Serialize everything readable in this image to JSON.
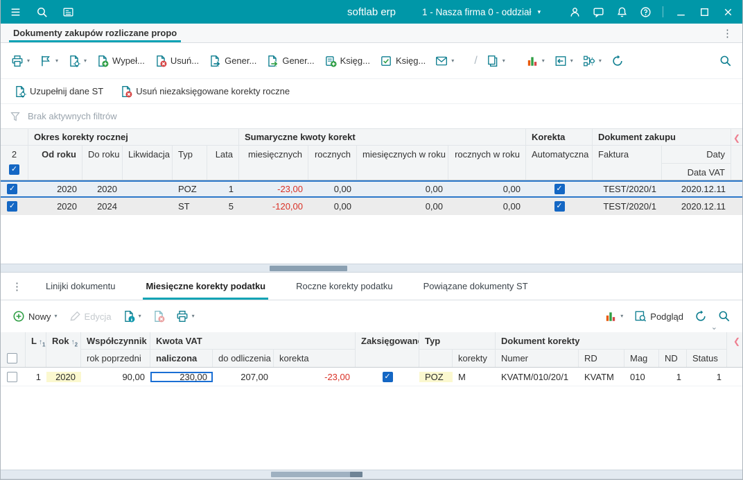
{
  "titlebar": {
    "app_name": "softlab erp",
    "company": "1 - Nasza firma 0 - oddział"
  },
  "tabbar": {
    "active_tab": "Dokumenty zakupów rozliczane propo"
  },
  "toolbar": {
    "wypelnij": "Wypeł...",
    "usun": "Usuń...",
    "generuj1": "Gener...",
    "generuj2": "Gener...",
    "ksieguj1": "Księg...",
    "ksieguj2": "Księg..."
  },
  "toolbar2": {
    "uzupelnij": "Uzupełnij dane ST",
    "usun_korekty": "Usuń niezaksięgowane korekty roczne"
  },
  "filterbar": {
    "status": "Brak aktywnych filtrów"
  },
  "main_table": {
    "record_count": "2",
    "groups": {
      "okres": "Okres korekty rocznej",
      "sumaryczne": "Sumaryczne kwoty korekt",
      "korekta": "Korekta",
      "dokument": "Dokument zakupu"
    },
    "columns": {
      "od_roku": "Od roku",
      "do_roku": "Do roku",
      "likwidacja": "Likwidacja",
      "typ": "Typ",
      "lata": "Lata",
      "miesiecznych": "miesięcznych",
      "rocznych": "rocznych",
      "miesiecznych_w_roku": "miesięcznych w roku",
      "rocznych_w_roku": "rocznych w roku",
      "automatyczna": "Automatyczna",
      "faktura": "Faktura",
      "daty": "Daty",
      "data_vat": "Data VAT"
    },
    "rows": [
      {
        "od_roku": "2020",
        "do_roku": "2020",
        "likwidacja": "",
        "typ": "POZ",
        "lata": "1",
        "miesiecznych": "-23,00",
        "rocznych": "0,00",
        "miesiecznych_w_roku": "0,00",
        "rocznych_w_roku": "0,00",
        "faktura": "TEST/2020/1",
        "data_vat": "2020.12.11"
      },
      {
        "od_roku": "2020",
        "do_roku": "2024",
        "likwidacja": "",
        "typ": "ST",
        "lata": "5",
        "miesiecznych": "-120,00",
        "rocznych": "0,00",
        "miesiecznych_w_roku": "0,00",
        "rocznych_w_roku": "0,00",
        "faktura": "TEST/2020/1",
        "data_vat": "2020.12.11"
      }
    ]
  },
  "detail_tabs": {
    "items": [
      "Linijki dokumentu",
      "Miesięczne korekty podatku",
      "Roczne korekty podatku",
      "Powiązane dokumenty ST"
    ]
  },
  "detail_toolbar": {
    "nowy": "Nowy",
    "edycja": "Edycja",
    "podglad": "Podgląd"
  },
  "detail_table": {
    "groups": {
      "l": "L",
      "rok": "Rok",
      "wspolczynnik": "Współczynnik",
      "kwota_vat": "Kwota VAT",
      "zaksiegowane": "Zaksięgowane",
      "typ": "Typ",
      "dokument_korekty": "Dokument korekty"
    },
    "columns": {
      "rok_poprzedni": "rok poprzedni",
      "naliczona": "naliczona",
      "do_odliczenia": "do odliczenia",
      "korekta": "korekta",
      "korekty": "korekty",
      "numer": "Numer",
      "rd": "RD",
      "mag": "Mag",
      "nd": "ND",
      "status": "Status"
    },
    "sort": {
      "l": "1",
      "rok": "2"
    },
    "rows": [
      {
        "l": "1",
        "rok": "2020",
        "rok_poprzedni": "90,00",
        "naliczona": "230,00",
        "do_odliczenia": "207,00",
        "korekta": "-23,00",
        "typ": "POZ",
        "typ_korekty": "M",
        "numer": "KVATM/010/20/1",
        "rd": "KVATM",
        "mag": "010",
        "nd": "1",
        "status": "1"
      }
    ]
  },
  "icons": {
    "chevron_down": "▾",
    "chevron_down_small": "⌄",
    "kebab": "⋮",
    "check": "✓",
    "scroll_left": "❮",
    "slash": "/",
    "sort_arrow": "↑"
  },
  "colors": {
    "accent": "#0097a8",
    "selection": "#2b77c9",
    "negative": "#d93025",
    "row_highlight": "#fbf8cf",
    "checkbox_checked": "#1467c4"
  }
}
